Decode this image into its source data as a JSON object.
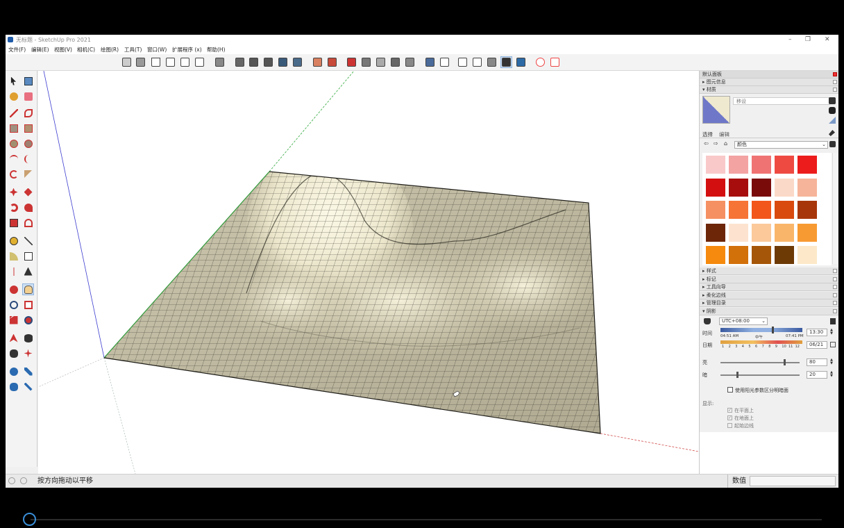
{
  "window": {
    "title": "无标题 - SketchUp Pro 2021",
    "controls": [
      "–",
      "❐",
      "✕"
    ]
  },
  "menu": [
    "文件(F)",
    "编辑(E)",
    "视图(V)",
    "相机(C)",
    "绘图(R)",
    "工具(T)",
    "窗口(W)",
    "扩展程序 (x)",
    "帮助(H)"
  ],
  "status": {
    "hint": "按方向拖动以平移",
    "measure_label": "数值",
    "measure_value": ""
  },
  "panel": {
    "tray_title": "默认面板",
    "entity_info": "图元信息",
    "materials": "材质",
    "material_name": "移设",
    "tab_select": "选择",
    "tab_edit": "编辑",
    "library": "颜色",
    "sections": [
      "样式",
      "标记",
      "工具向导",
      "柔化边线",
      "管理目录"
    ],
    "shadows": "阴影",
    "timezone": "UTC+08:00",
    "time_label": "时间",
    "time_start": "04:51 AM",
    "time_mid": "中午",
    "time_end": "07:41 PM",
    "time_value": "13:30",
    "date_label": "日期",
    "months": [
      "1",
      "2",
      "3",
      "4",
      "5",
      "6",
      "7",
      "8",
      "9",
      "10",
      "11",
      "12"
    ],
    "date_value": "06/21",
    "light_label": "亮",
    "light_value": "80",
    "dark_label": "暗",
    "dark_value": "20",
    "light_level": 0.8,
    "dark_level": 0.2,
    "sun_shading": "使用阳光参数区分明暗面",
    "display_label": "显示:",
    "display_options": [
      "在平面上",
      "在地面上",
      "起始边线"
    ],
    "colors": [
      "#f9c9c9",
      "#f4a3a3",
      "#f07373",
      "#ee4a42",
      "#ec1c1c",
      "#d40f0f",
      "#a70d0d",
      "#7a0b0b",
      "#fbd9c9",
      "#f6b49a",
      "#f59062",
      "#f67436",
      "#f2561a",
      "#d94a0e",
      "#a7360a",
      "#6d2608",
      "#fde3cf",
      "#fbc99a",
      "#f9b66a",
      "#f79a32",
      "#f58a0e",
      "#d2700a",
      "#a65608",
      "#6d3a06",
      "#fde9c9"
    ]
  }
}
